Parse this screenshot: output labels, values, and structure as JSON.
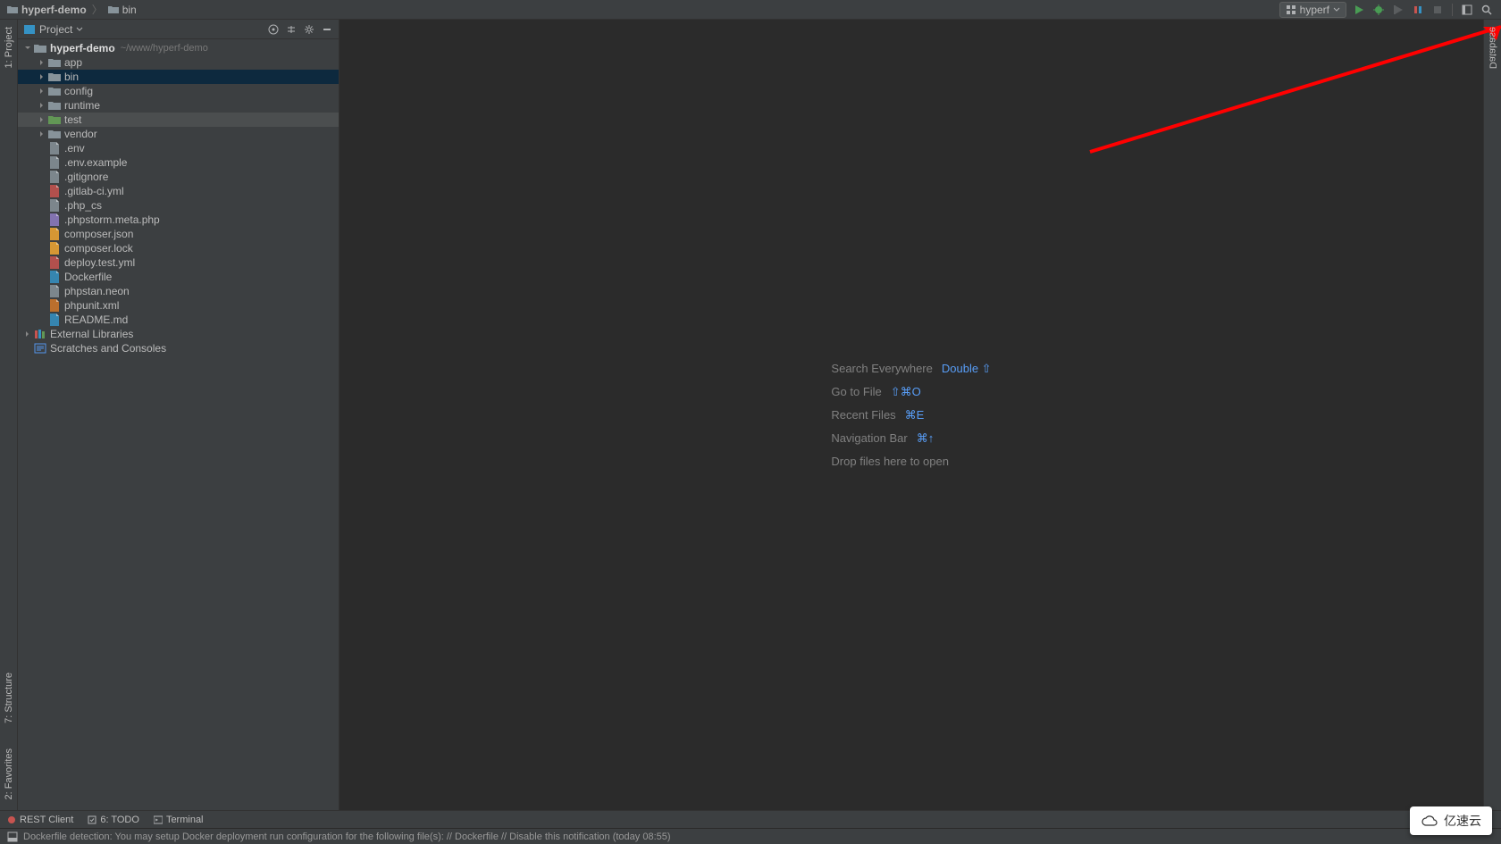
{
  "breadcrumb": {
    "root": "hyperf-demo",
    "child": "bin"
  },
  "run_config": {
    "label": "hyperf"
  },
  "project_panel": {
    "title": "Project",
    "root": {
      "name": "hyperf-demo",
      "path": "~/www/hyperf-demo"
    },
    "folders": [
      {
        "name": "app",
        "expanded": false
      },
      {
        "name": "bin",
        "expanded": false,
        "selected": true
      },
      {
        "name": "config",
        "expanded": false
      },
      {
        "name": "runtime",
        "expanded": false
      },
      {
        "name": "test",
        "expanded": false,
        "highlight": true,
        "color": "green"
      },
      {
        "name": "vendor",
        "expanded": false
      }
    ],
    "files": [
      {
        "name": ".env",
        "icon": "file"
      },
      {
        "name": ".env.example",
        "icon": "file"
      },
      {
        "name": ".gitignore",
        "icon": "file"
      },
      {
        "name": ".gitlab-ci.yml",
        "icon": "yml"
      },
      {
        "name": ".php_cs",
        "icon": "file"
      },
      {
        "name": ".phpstorm.meta.php",
        "icon": "php"
      },
      {
        "name": "composer.json",
        "icon": "json"
      },
      {
        "name": "composer.lock",
        "icon": "json"
      },
      {
        "name": "deploy.test.yml",
        "icon": "yml"
      },
      {
        "name": "Dockerfile",
        "icon": "docker"
      },
      {
        "name": "phpstan.neon",
        "icon": "file"
      },
      {
        "name": "phpunit.xml",
        "icon": "xml"
      },
      {
        "name": "README.md",
        "icon": "md"
      }
    ],
    "external": "External Libraries",
    "scratches": "Scratches and Consoles"
  },
  "welcome": {
    "rows": [
      {
        "label": "Search Everywhere",
        "shortcut": "Double ⇧"
      },
      {
        "label": "Go to File",
        "shortcut": "⇧⌘O"
      },
      {
        "label": "Recent Files",
        "shortcut": "⌘E"
      },
      {
        "label": "Navigation Bar",
        "shortcut": "⌘↑"
      },
      {
        "label": "Drop files here to open",
        "shortcut": ""
      }
    ]
  },
  "left_gutter": {
    "project": "1: Project",
    "structure": "7: Structure",
    "favorites": "2: Favorites"
  },
  "right_gutter": {
    "database": "Database"
  },
  "bottom_tabs": {
    "rest": "REST Client",
    "todo": "6: TODO",
    "terminal": "Terminal"
  },
  "status": {
    "msg": "Dockerfile detection: You may setup Docker deployment run configuration for the following file(s): // Dockerfile // Disable this notification (today 08:55)"
  },
  "watermark": "亿速云"
}
